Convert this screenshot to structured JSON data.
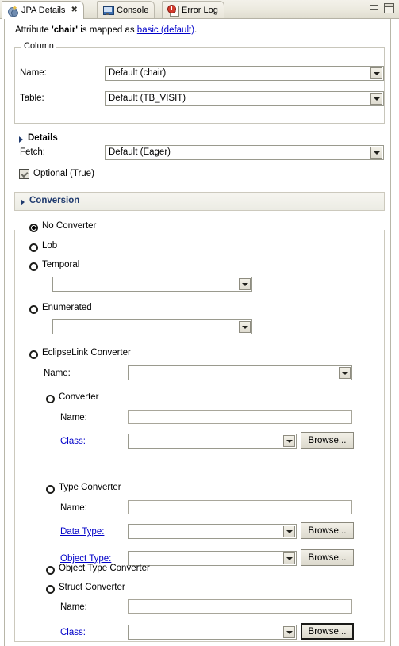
{
  "window": {
    "minimize_label": "Minimize",
    "maximize_label": "Maximize"
  },
  "tabs": [
    {
      "label": "JPA Details",
      "icon": "jpa-details-icon",
      "active": true,
      "closable": true,
      "close_glyph": "✖"
    },
    {
      "label": "Console",
      "icon": "console-icon",
      "active": false,
      "closable": false
    },
    {
      "label": "Error Log",
      "icon": "error-log-icon",
      "active": false,
      "closable": false
    }
  ],
  "intro": {
    "prefix": "Attribute ",
    "attribute": "'chair'",
    "middle": " is mapped as ",
    "link": "basic (default)",
    "suffix": "."
  },
  "column_group": {
    "title": "Column",
    "name_label": "Name:",
    "name_value": "Default (chair)",
    "table_label": "Table:",
    "table_value": "Default (TB_VISIT)",
    "details_label": "Details"
  },
  "fetch": {
    "label": "Fetch:",
    "value": "Default (Eager)"
  },
  "optional": {
    "label": "Optional (True)",
    "checked": true
  },
  "conversion": {
    "title": "Conversion",
    "options": {
      "no_converter": "No Converter",
      "lob": "Lob",
      "temporal": "Temporal",
      "temporal_value": "",
      "enumerated": "Enumerated",
      "enumerated_value": "",
      "eclipselink_converter": "EclipseLink Converter",
      "eclipselink_name_label": "Name:",
      "eclipselink_name_value": "",
      "converter": "Converter",
      "converter_name_label": "Name:",
      "converter_name_value": "",
      "converter_class_label": "Class:",
      "converter_class_value": "",
      "converter_browse": "Browse...",
      "type_converter": "Type Converter",
      "type_name_label": "Name:",
      "type_name_value": "",
      "data_type_label": "Data Type:",
      "data_type_value": "",
      "data_type_browse": "Browse...",
      "object_type_label": "Object Type:",
      "object_type_value": "",
      "object_type_browse": "Browse...",
      "object_type_converter": "Object Type Converter",
      "struct_converter": "Struct Converter",
      "struct_name_label": "Name:",
      "struct_name_value": "",
      "struct_class_label": "Class:",
      "struct_class_value": "",
      "struct_browse": "Browse..."
    },
    "selected": "no_converter"
  },
  "colors": {
    "link": "#0000c8",
    "section_title": "#1f3a6e",
    "panel_bg": "#ffffff",
    "tab_bg": "#e0ddd0"
  }
}
